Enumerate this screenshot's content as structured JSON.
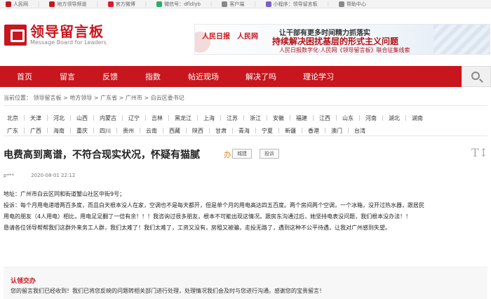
{
  "topbar": {
    "items": [
      {
        "label": "人民网",
        "icon": "people-daily-icon",
        "color": "#c8161e"
      },
      {
        "label": "地方领导频道",
        "icon": "channel-icon",
        "color": "#c8161e"
      },
      {
        "label": "官方微博",
        "icon": "weibo-icon",
        "color": "#e6162d"
      },
      {
        "label": "微信号：dfldlyb",
        "icon": "wechat-icon",
        "color": "#2aae67"
      },
      {
        "label": "客户端",
        "icon": "mobile-app-icon",
        "color": "#888888"
      },
      {
        "label": "小程序：领导留言板",
        "icon": "mini-program-icon",
        "color": "#7b5fc9"
      },
      {
        "label": "帮助中心",
        "icon": "help-icon",
        "color": "#888888"
      }
    ]
  },
  "logo": {
    "cn": "领导留言板",
    "en": "Message Board for Leaders"
  },
  "banner": {
    "logo_left": "人民日报",
    "logo_right": "人民网",
    "line1": "让干部有更多时间精力抓落实",
    "line2": "持续解决困扰基层的形式主义问题",
    "line3": "人民日报数字化·人民网《领导留言板》联合征集线索"
  },
  "nav": [
    "首页",
    "留言",
    "反馈",
    "指数",
    "帖近现场",
    "解决了吗",
    "理论学习"
  ],
  "breadcrumb": "当前位置： 领导留言板 > 地方领导 > 广东省 > 广州市 > 白云区委书记",
  "provinces": [
    [
      "北京",
      "天津",
      "河北",
      "山西",
      "内蒙古",
      "辽宁",
      "吉林",
      "黑龙江",
      "上海",
      "江苏",
      "浙江",
      "安徽",
      "福建",
      "江西",
      "山东",
      "河南",
      "湖北",
      "湖南"
    ],
    [
      "广东",
      "广西",
      "海南",
      "重庆",
      "四川",
      "贵州",
      "云南",
      "西藏",
      "陕西",
      "甘肃",
      "青海",
      "宁夏",
      "新疆",
      "香港",
      "澳门",
      "台湾"
    ]
  ],
  "post": {
    "title": "电费高到离谱，不符合现实状况，怀疑有猫腻",
    "status": "办理中",
    "tags": [
      "城建",
      "投诉"
    ],
    "author": "p***",
    "date": "2020-08-01 22:12",
    "address": "地址：广州市白云区同和街道蟹山社区中街9号；",
    "body_lines": [
      "投诉：每个月用电递增两百多度，而且白天根本没人在家，空调也不是每天都开，但是单个月的用电高达四五百度。两个房间两个空调，一个冰箱，没开过热水器，跟居民",
      "用电的朋友（4人用电）相比，用电足足翻了一倍有余！！！我咨询过很多朋友，根本不可能出现这情况。跟房东沟通过后，她坚持电表没问题，我们根本没办法！！",
      "恳请各位领导帮帮我们这群外来务工人群，我们太难了！我们太难了，工资又没有，房租又被骗，走投无路了，遇到这种不公平待遇，让我对广州感到失望。"
    ]
  },
  "reply": {
    "title": "认领交办",
    "text": "您的留言我们已经收到！我们已将您反映的问题转相关部门进行处理，处理情况我们会及时与您进行沟通。感谢您的宝贵留言！"
  }
}
